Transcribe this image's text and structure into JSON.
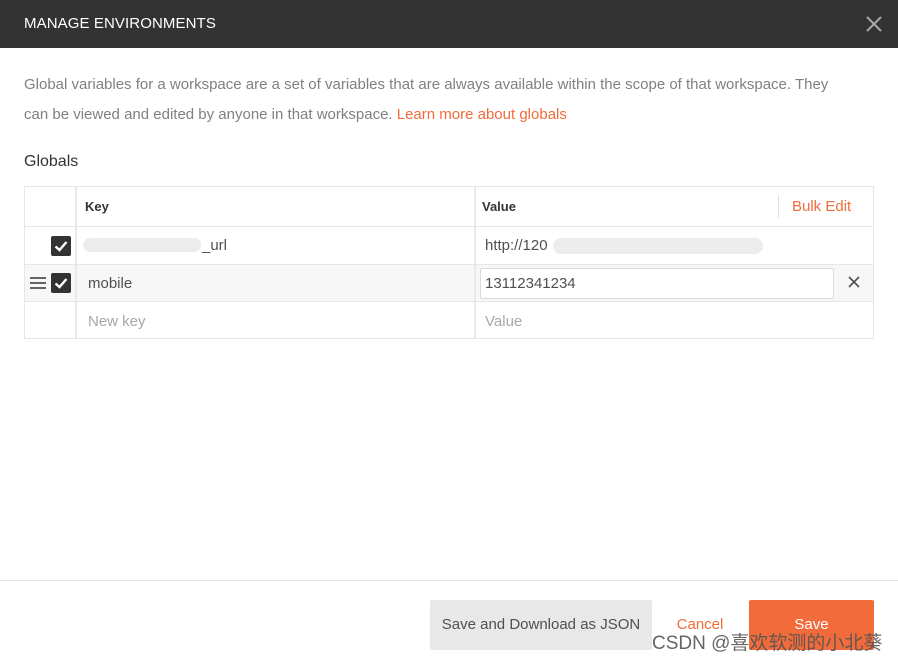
{
  "dialog": {
    "title": "MANAGE ENVIRONMENTS",
    "close_icon": "close-icon"
  },
  "description": {
    "line1": "Global variables for a workspace are a set of variables that are always available within the scope of that workspace. They",
    "line2": "can be viewed and edited by anyone in that workspace.",
    "link": "Learn more about globals"
  },
  "globals": {
    "section_title": "Globals",
    "header": {
      "key": "Key",
      "value": "Value",
      "bulk_edit": "Bulk Edit"
    },
    "rows": [
      {
        "key": "_url",
        "value": "http://120",
        "checked": true
      },
      {
        "key": "mobile",
        "value": "13112341234",
        "checked": true
      }
    ],
    "new_row": {
      "key_placeholder": "New key",
      "value_placeholder": "Value"
    }
  },
  "footer": {
    "download": "Save and Download as JSON",
    "cancel": "Cancel",
    "save": "Save"
  },
  "watermark": "CSDN @喜欢软测的小北葵",
  "colors": {
    "accent": "#f26b3a",
    "titlebar": "#333333",
    "checkbox": "#333333"
  }
}
